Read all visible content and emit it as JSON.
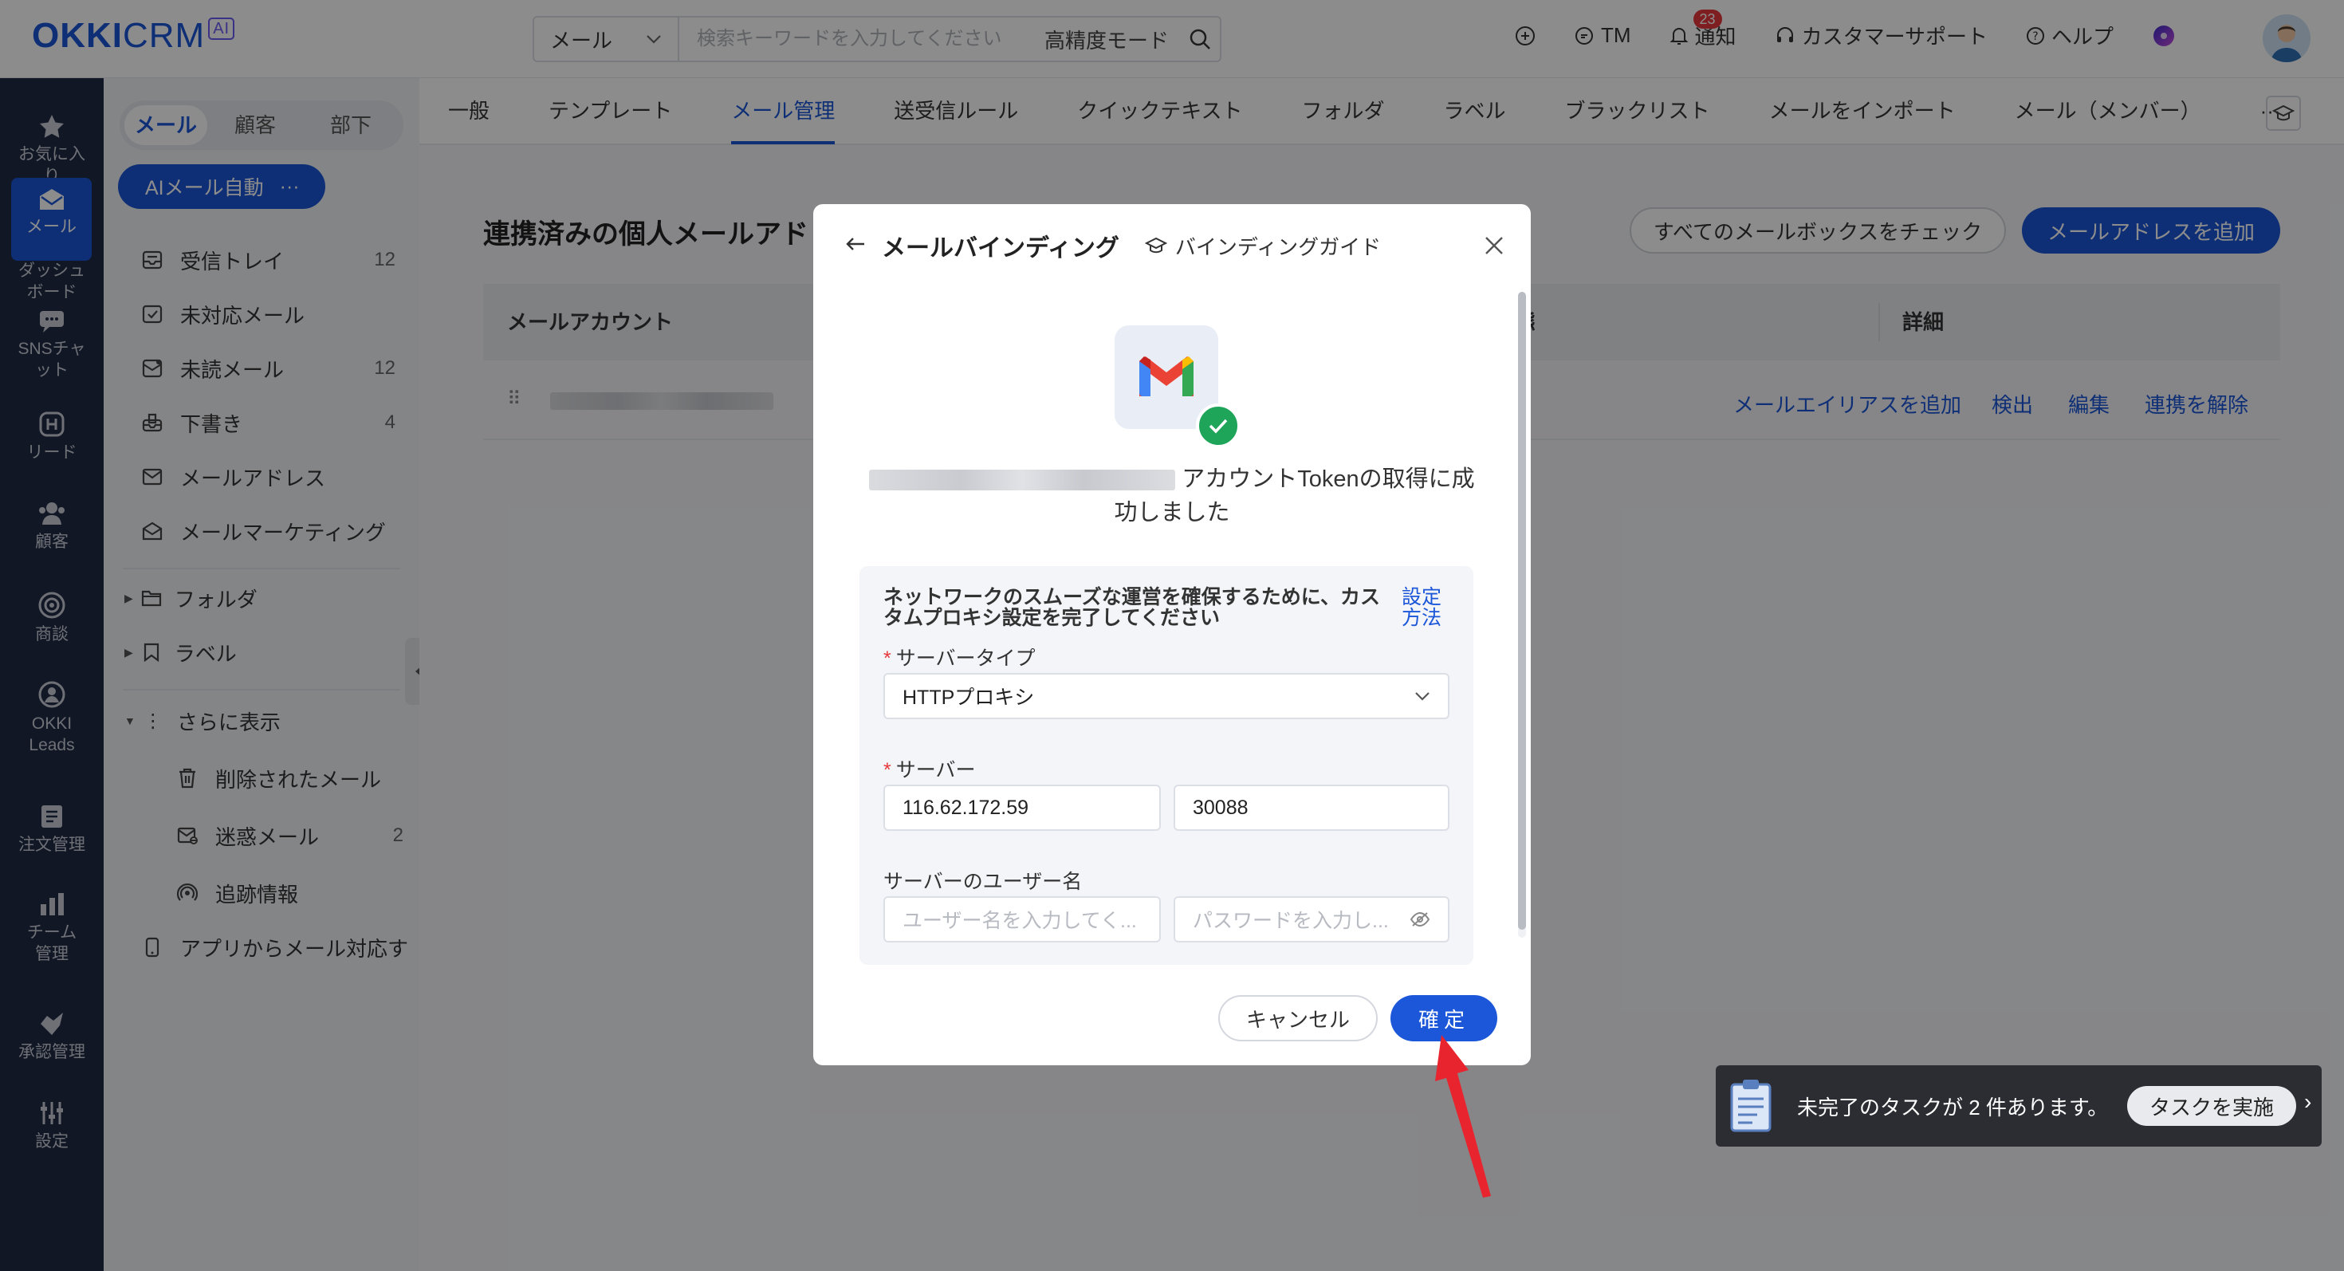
{
  "app": {
    "logo_main": "OKKI",
    "logo_crm": "CRM",
    "logo_ai": "AI"
  },
  "search": {
    "scope": "メール",
    "placeholder": "検索キーワードを入力してください",
    "mode": "高精度モード"
  },
  "topbar": {
    "tm": "TM",
    "notify": "通知",
    "notify_count": "23",
    "support": "カスタマーサポート",
    "help": "ヘルプ"
  },
  "leftnav": [
    {
      "icon": "star-icon",
      "label": "お気に入り"
    },
    {
      "icon": "dashboard-icon",
      "label": "ダッシュボード"
    },
    {
      "icon": "mail-icon",
      "label": "メール"
    },
    {
      "icon": "chat-icon",
      "label": "SNSチャット"
    },
    {
      "icon": "leads-icon",
      "label": "リード"
    },
    {
      "icon": "customers-icon",
      "label": "顧客"
    },
    {
      "icon": "target-icon",
      "label": "商談"
    },
    {
      "icon": "okki-leads-icon",
      "label": "OKKI Leads"
    },
    {
      "icon": "order-icon",
      "label": "注文管理"
    },
    {
      "icon": "team-chart-icon",
      "label": "チーム管理"
    },
    {
      "icon": "approval-icon",
      "label": "承認管理"
    },
    {
      "icon": "settings-icon",
      "label": "設定"
    }
  ],
  "subside": {
    "tabs": [
      "メール",
      "顧客",
      "部下"
    ],
    "ai_button": "AIメール自動",
    "ai_more": "···",
    "items": [
      {
        "label": "受信トレイ",
        "count": "12"
      },
      {
        "label": "未対応メール",
        "count": ""
      },
      {
        "label": "未読メール",
        "count": "12"
      },
      {
        "label": "下書き",
        "count": "4"
      },
      {
        "label": "メールアドレス",
        "count": ""
      },
      {
        "label": "メールマーケティング",
        "count": ""
      }
    ],
    "folder": "フォルダ",
    "label": "ラベル",
    "more": "さらに表示",
    "more_items": [
      {
        "label": "削除されたメール",
        "count": ""
      },
      {
        "label": "迷惑メール",
        "count": "2"
      },
      {
        "label": "追跡情報",
        "count": ""
      }
    ],
    "app_mail": "アプリからメール対応す"
  },
  "main": {
    "tabs": [
      "一般",
      "テンプレート",
      "メール管理",
      "送受信ルール",
      "クイックテキスト",
      "フォルダ",
      "ラベル",
      "ブラックリスト",
      "メールをインポート",
      "メール（メンバー）",
      "···"
    ],
    "title": "連携済みの個人メールアドレス",
    "check_all": "すべてのメールボックスをチェック",
    "add_address": "メールアドレスを追加",
    "col_account": "メールアカウント",
    "col_status_tail": "態",
    "col_detail": "詳細",
    "row_actions": [
      "メールエイリアスを追加",
      "検出",
      "編集",
      "連携を解除"
    ]
  },
  "modal": {
    "title": "メールバインディング",
    "guide": "バインディングガイド",
    "success_text": "アカウントTokenの取得に成功しました",
    "proxy_note": "ネットワークのスムーズな運営を確保するために、カスタムプロキシ設定を完了してください",
    "proxy_link": "設定方法",
    "server_type_label": "サーバータイプ",
    "server_type_value": "HTTPプロキシ",
    "server_label": "サーバー",
    "server_host": "116.62.172.59",
    "server_port": "30088",
    "username_label": "サーバーのユーザー名",
    "username_placeholder": "ユーザー名を入力してく...",
    "password_placeholder": "パスワードを入力し...",
    "cancel": "キャンセル",
    "confirm": "確定"
  },
  "task": {
    "text": "未完了のタスクが 2 件あります。",
    "button": "タスクを実施"
  },
  "colors": {
    "accent": "#1b57d8",
    "nav_bg": "#1f2a44",
    "success": "#1fa55a",
    "badge": "#e5383b"
  }
}
